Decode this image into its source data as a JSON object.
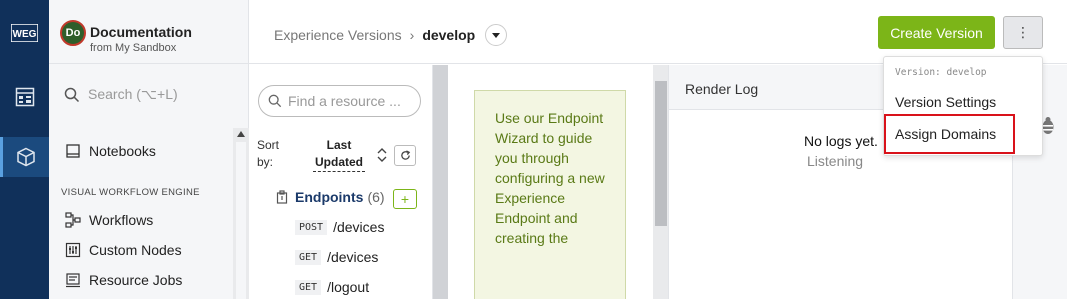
{
  "rail": {
    "logo_text": "WEG",
    "icons": [
      "weg-logo-icon",
      "dashboard-icon",
      "cube-icon"
    ],
    "colors": {
      "background": "#10305a",
      "active": "#1b4a7e"
    }
  },
  "app": {
    "avatar_initials": "Do",
    "title": "Documentation",
    "subtitle": "from My Sandbox"
  },
  "sidebar": {
    "search_placeholder": "Search (⌥+L)",
    "items": [
      {
        "label": "Notebooks",
        "icon": "notebook-icon"
      }
    ],
    "section_title": "VISUAL WORKFLOW ENGINE",
    "section_items": [
      {
        "label": "Workflows",
        "icon": "workflow-icon"
      },
      {
        "label": "Custom Nodes",
        "icon": "custom-nodes-icon"
      },
      {
        "label": "Resource Jobs",
        "icon": "resource-jobs-icon"
      }
    ]
  },
  "breadcrumb": {
    "parent": "Experience Versions",
    "separator": "›",
    "current": "develop"
  },
  "toolbar": {
    "create_label": "Create Version",
    "more_label": "⋮",
    "create_color": "#7cb518"
  },
  "resources": {
    "find_placeholder": "Find a resource ...",
    "sort_label": "Sort by:",
    "sort_value": "Last Updated",
    "endpoints_label": "Endpoints",
    "endpoints_count": "(6)",
    "add_label": "+",
    "endpoints": [
      {
        "method": "POST",
        "path": "/devices"
      },
      {
        "method": "GET",
        "path": "/devices"
      },
      {
        "method": "GET",
        "path": "/logout"
      }
    ]
  },
  "editor": {
    "tip_text": "Use our Endpoint Wizard to guide you through configuring a new Experience Endpoint and creating the"
  },
  "render_log": {
    "title": "Render Log",
    "empty_text": "No logs yet.",
    "status_text": "Listening"
  },
  "dropdown": {
    "version_label": "Version: develop",
    "items": [
      "Version Settings",
      "Assign Domains"
    ],
    "highlight_color": "#d9121a"
  }
}
